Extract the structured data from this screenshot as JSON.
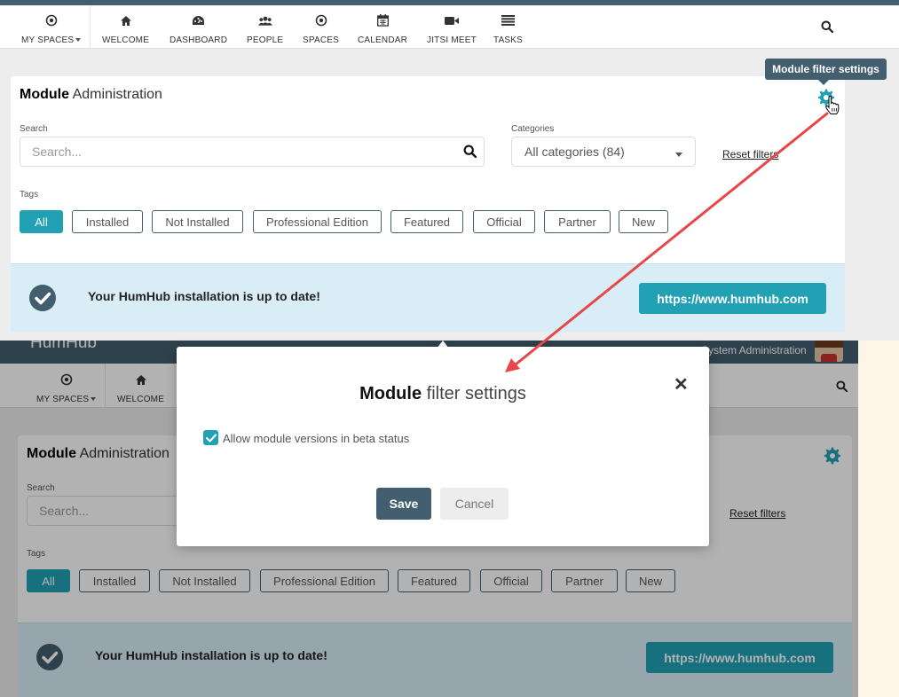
{
  "nav": {
    "my_spaces": "MY SPACES",
    "items": [
      {
        "label": "WELCOME",
        "icon": "home-icon"
      },
      {
        "label": "DASHBOARD",
        "icon": "dashboard-icon"
      },
      {
        "label": "PEOPLE",
        "icon": "people-icon"
      },
      {
        "label": "SPACES",
        "icon": "spaces-icon"
      },
      {
        "label": "CALENDAR",
        "icon": "calendar-icon"
      },
      {
        "label": "JITSI MEET",
        "icon": "video-icon"
      },
      {
        "label": "TASKS",
        "icon": "tasks-icon"
      }
    ]
  },
  "panel": {
    "title_bold": "Module",
    "title_rest": " Administration",
    "search_label": "Search",
    "search_placeholder": "Search...",
    "categories_label": "Categories",
    "categories_value": "All categories (84)",
    "reset_filters": "Reset filters",
    "tags_label": "Tags",
    "tags": [
      "All",
      "Installed",
      "Not Installed",
      "Professional Edition",
      "Featured",
      "Official",
      "Partner",
      "New"
    ],
    "info_text": "Your HumHub installation is up to date!",
    "info_link": "https://www.humhub.com"
  },
  "tooltip": "Module filter settings",
  "lower": {
    "brand": "HumHub",
    "sysadmin": "System Administration"
  },
  "modal": {
    "title_bold": "Module",
    "title_rest": " filter settings",
    "checkbox_label": "Allow module versions in beta status",
    "checkbox_checked": true,
    "save": "Save",
    "cancel": "Cancel"
  },
  "colors": {
    "primary": "#21a1b3",
    "header": "#435f6f",
    "info_bg": "#d9edf7",
    "arrow": "#e8474a"
  }
}
